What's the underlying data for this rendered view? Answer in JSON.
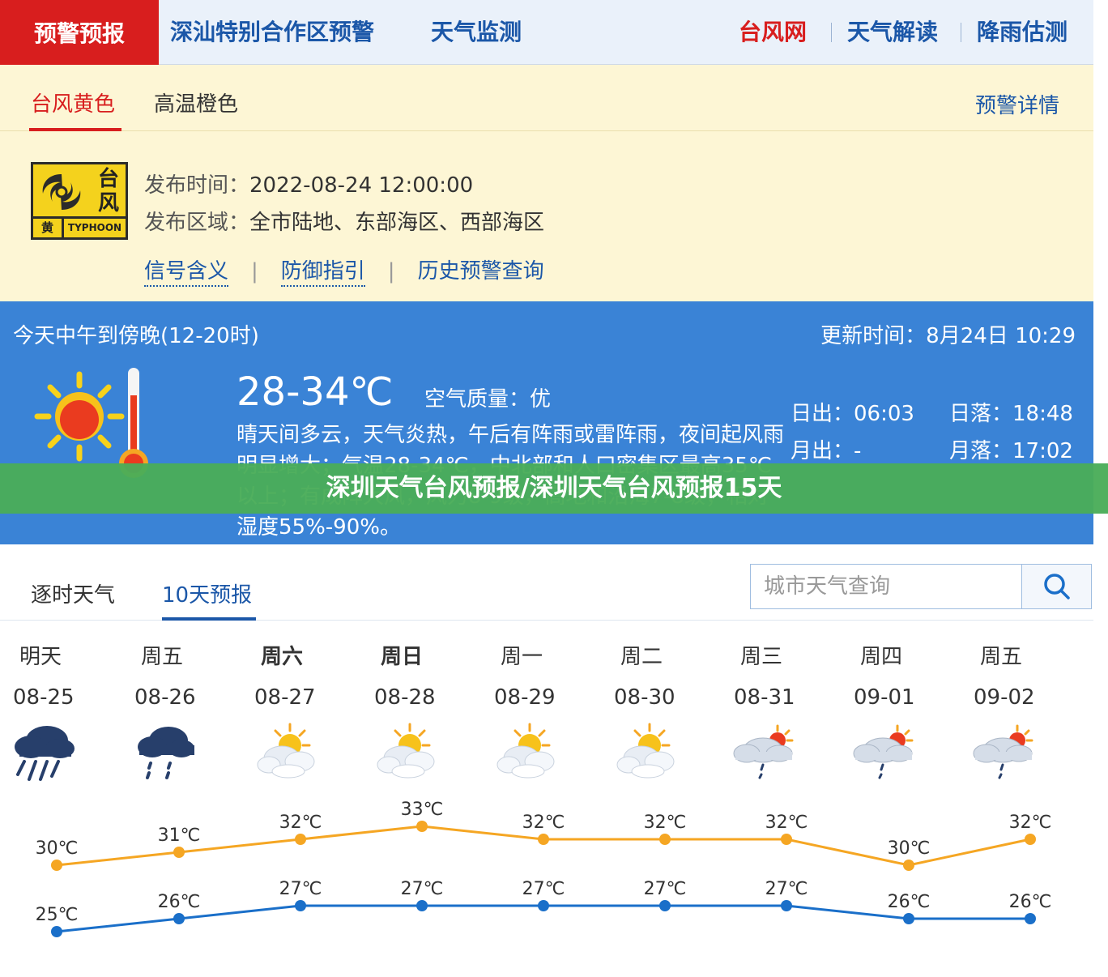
{
  "nav": {
    "brand": "预警预报",
    "links": [
      "深汕特别合作区预警",
      "天气监测"
    ],
    "right_links": [
      "台风网",
      "天气解读",
      "降雨估测"
    ]
  },
  "warning": {
    "tabs": [
      "台风黄色",
      "高温橙色"
    ],
    "detail_link": "预警详情",
    "signal": {
      "char1": "台",
      "char2": "风",
      "level": "黄",
      "en": "TYPHOON",
      "icon": "typhoon-icon"
    },
    "publish_time_label": "发布时间：",
    "publish_time": "2022-08-24 12:00:00",
    "area_label": "发布区域：",
    "area": "全市陆地、东部海区、西部海区",
    "links": [
      "信号含义",
      "防御指引",
      "历史预警查询"
    ]
  },
  "weather": {
    "period": "今天中午到傍晚(12-20时)",
    "update_label": "更新时间：",
    "update_time": "8月24日 10:29",
    "temp_range": "28-34℃",
    "aqi_label": "空气质量：",
    "aqi": "优",
    "description": "晴天间多云，天气炎热，午后有阵雨或雷阵雨，夜间起风雨明显增大；气温28-34℃，中北部和人口密集区最高35℃以上；有成阵大风，风力8-9级，高地和沿海7-8级；相对湿度55%-90%。",
    "sunrise_label": "日出：",
    "sunrise": "06:03",
    "sunset_label": "日落：",
    "sunset": "18:48",
    "moonrise_label": "月出：",
    "moonrise": "-",
    "moonset_label": "月落：",
    "moonset": "17:02"
  },
  "banner": {
    "text": "深圳天气台风预报/深圳天气台风预报15天"
  },
  "forecast": {
    "tabs": [
      "逐时天气",
      "10天预报"
    ],
    "search_placeholder": "城市天气查询",
    "days": [
      {
        "day": "明天",
        "date": "08-25",
        "icon": "heavy-rain-icon",
        "high": "30℃",
        "low": "25℃",
        "bold": false
      },
      {
        "day": "周五",
        "date": "08-26",
        "icon": "rain-icon",
        "high": "31℃",
        "low": "26℃",
        "bold": false
      },
      {
        "day": "周六",
        "date": "08-27",
        "icon": "partly-cloudy-icon",
        "high": "32℃",
        "low": "27℃",
        "bold": true
      },
      {
        "day": "周日",
        "date": "08-28",
        "icon": "partly-cloudy-icon",
        "high": "33℃",
        "low": "27℃",
        "bold": true
      },
      {
        "day": "周一",
        "date": "08-29",
        "icon": "partly-cloudy-icon",
        "high": "32℃",
        "low": "27℃",
        "bold": false
      },
      {
        "day": "周二",
        "date": "08-30",
        "icon": "partly-cloudy-icon",
        "high": "32℃",
        "low": "27℃",
        "bold": false
      },
      {
        "day": "周三",
        "date": "08-31",
        "icon": "sun-shower-icon",
        "high": "32℃",
        "low": "27℃",
        "bold": false
      },
      {
        "day": "周四",
        "date": "09-01",
        "icon": "sun-shower-icon",
        "high": "30℃",
        "low": "26℃",
        "bold": false
      },
      {
        "day": "周五",
        "date": "09-02",
        "icon": "sun-shower-icon",
        "high": "32℃",
        "low": "26℃",
        "bold": false
      }
    ],
    "high_values": [
      30,
      31,
      32,
      33,
      32,
      32,
      32,
      30,
      32
    ],
    "low_values": [
      25,
      26,
      27,
      27,
      27,
      27,
      27,
      26,
      26
    ],
    "colors": {
      "high": "#f5a623",
      "low": "#1a6fc9"
    }
  },
  "colors": {
    "brand_red": "#d81e1e",
    "link_blue": "#1b57a8",
    "weather_bg": "#3a83d6",
    "warning_bg": "#fdf6d5",
    "banner_green": "#4aad58"
  }
}
